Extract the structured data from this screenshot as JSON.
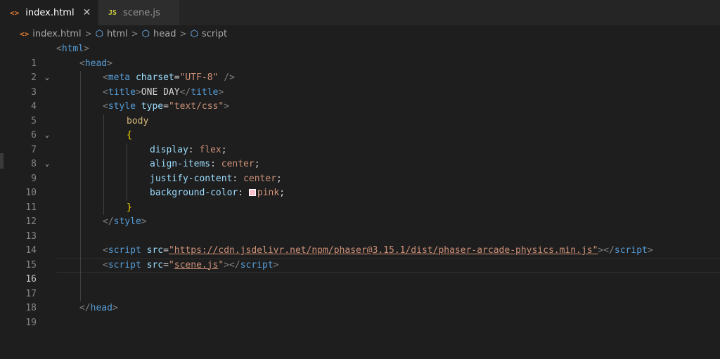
{
  "tabs": [
    {
      "icon": "<>",
      "label": "index.html",
      "close": "✕"
    },
    {
      "icon": "JS",
      "label": "scene.js"
    }
  ],
  "breadcrumb": {
    "file_icon": "<>",
    "file": "index.html",
    "items": [
      "html",
      "head",
      "script"
    ],
    "separator": ">"
  },
  "editor": {
    "current_line": 16,
    "lines": [
      {
        "n": "1"
      },
      {
        "n": "2"
      },
      {
        "n": "3"
      },
      {
        "n": "4"
      },
      {
        "n": "5"
      },
      {
        "n": "6"
      },
      {
        "n": "7"
      },
      {
        "n": "8"
      },
      {
        "n": "9"
      },
      {
        "n": "10"
      },
      {
        "n": "11"
      },
      {
        "n": "12"
      },
      {
        "n": "13"
      },
      {
        "n": "14"
      },
      {
        "n": "15"
      },
      {
        "n": "16"
      },
      {
        "n": "17"
      },
      {
        "n": "18"
      },
      {
        "n": "19"
      }
    ],
    "tokens": {
      "lt": "<",
      "gt": ">",
      "lt_slash": "</",
      "self_close": " />",
      "html": "html",
      "head": "head",
      "meta": "meta",
      "charset_attr": "charset",
      "eq": "=",
      "charset_val": "\"UTF-8\"",
      "title": "title",
      "title_text": "ONE DAY",
      "style": "style",
      "type_attr": "type",
      "type_val": "\"text/css\"",
      "body_sel": "body",
      "brace_open": "{",
      "brace_close": "}",
      "p_display": "display",
      "v_display": "flex",
      "p_align": "align-items",
      "v_align": "center",
      "p_justify": "justify-content",
      "v_justify": "center",
      "p_bg": "background-color",
      "v_bg": "pink",
      "colon": ": ",
      "semi": ";",
      "script": "script",
      "src_attr": "src",
      "src1": "\"https://cdn.jsdelivr.net/npm/phaser@3.15.1/dist/phaser-arcade-physics.min.js\"",
      "src2_q1": "\"",
      "src2": "scene.js",
      "src2_q2": "\""
    }
  },
  "colors": {
    "background": "#1e1e1e",
    "tag": "#569cd6",
    "attribute": "#9cdcfe",
    "string": "#ce9178",
    "selector": "#d7ba7d",
    "brace": "#ffd700",
    "pink_swatch": "#ffc0cb"
  }
}
